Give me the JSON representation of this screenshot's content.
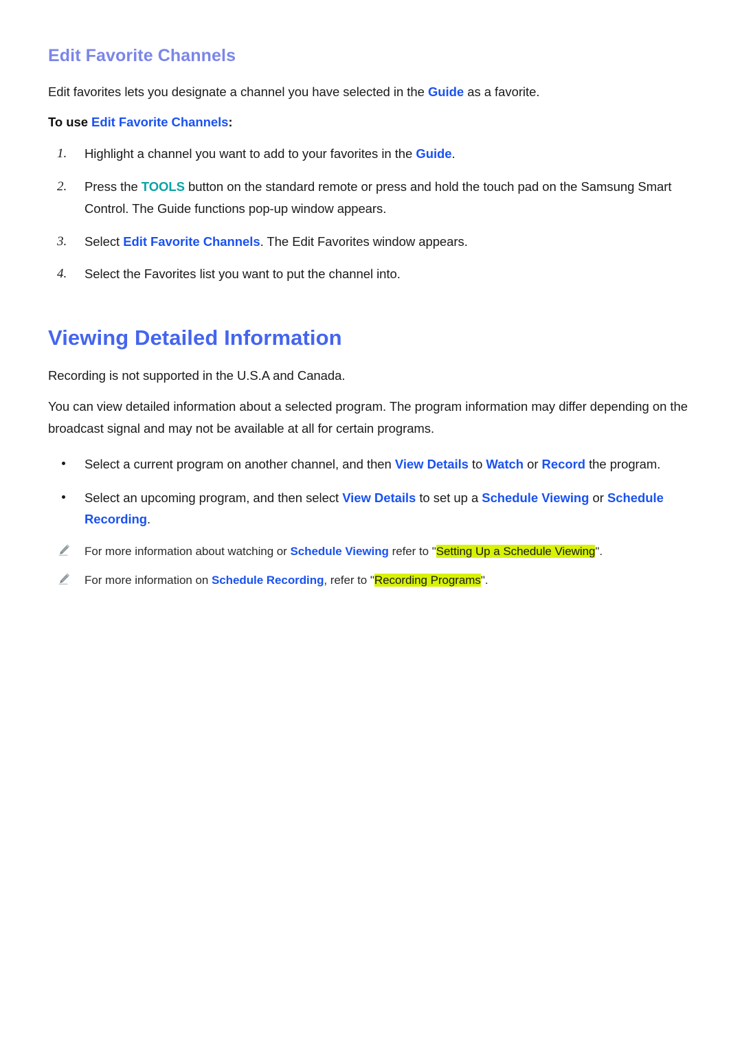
{
  "colors": {
    "section_heading": "#7b86e8",
    "page_heading": "#4565ee",
    "keyword_blue": "#1a52f0",
    "keyword_teal": "#0aa3a3",
    "highlight_green": "#d7f205",
    "body_text": "#1a1a1a",
    "page_background": "#ffffff"
  },
  "section": {
    "heading": "Edit Favorite Channels",
    "intro": {
      "before_guide": "Edit favorites lets you designate a channel you have selected in the ",
      "guide": "Guide",
      "after_guide": " as a favorite."
    },
    "lead_in": {
      "prefix": "To use ",
      "keyword": "Edit Favorite Channels",
      "suffix": ":"
    },
    "steps": [
      {
        "num": "1.",
        "parts": [
          {
            "text": "Highlight a channel you want to add to your favorites in the ",
            "style": "plain"
          },
          {
            "text": "Guide",
            "style": "kw"
          },
          {
            "text": ".",
            "style": "plain"
          }
        ]
      },
      {
        "num": "2.",
        "parts": [
          {
            "text": "Press the ",
            "style": "plain"
          },
          {
            "text": "TOOLS",
            "style": "kw-teal"
          },
          {
            "text": " button on the standard remote or press and hold the touch pad on the Samsung Smart Control. The Guide functions pop-up window appears.",
            "style": "plain"
          }
        ]
      },
      {
        "num": "3.",
        "parts": [
          {
            "text": "Select ",
            "style": "plain"
          },
          {
            "text": "Edit Favorite Channels",
            "style": "kw"
          },
          {
            "text": ". The Edit Favorites window appears.",
            "style": "plain"
          }
        ]
      },
      {
        "num": "4.",
        "parts": [
          {
            "text": "Select the Favorites list you want to put the channel into.",
            "style": "plain"
          }
        ]
      }
    ]
  },
  "chapter": {
    "heading": "Viewing Detailed Information",
    "note_region": "Recording is not supported in the U.S.A and Canada.",
    "description": "You can view detailed information about a selected program. The program information may differ depending on the broadcast signal and may not be available at all for certain programs.",
    "bullets": [
      {
        "parts": [
          {
            "text": "Select a current program on another channel, and then ",
            "style": "plain"
          },
          {
            "text": "View Details",
            "style": "kw"
          },
          {
            "text": " to ",
            "style": "plain"
          },
          {
            "text": "Watch",
            "style": "kw"
          },
          {
            "text": " or ",
            "style": "plain"
          },
          {
            "text": "Record",
            "style": "kw"
          },
          {
            "text": " the program.",
            "style": "plain"
          }
        ]
      },
      {
        "parts": [
          {
            "text": "Select an upcoming program, and then select ",
            "style": "plain"
          },
          {
            "text": "View Details",
            "style": "kw"
          },
          {
            "text": " to set up a ",
            "style": "plain"
          },
          {
            "text": "Schedule Viewing",
            "style": "kw"
          },
          {
            "text": " or ",
            "style": "plain"
          },
          {
            "text": "Schedule Recording",
            "style": "kw"
          },
          {
            "text": ".",
            "style": "plain"
          }
        ]
      }
    ],
    "notes": [
      {
        "icon": "pencil-icon",
        "parts": [
          {
            "text": "For more information about watching or ",
            "style": "plain"
          },
          {
            "text": "Schedule Viewing",
            "style": "kw"
          },
          {
            "text": " refer to \"",
            "style": "plain"
          },
          {
            "text": "Setting Up a Schedule Viewing",
            "style": "hl"
          },
          {
            "text": "\".",
            "style": "plain"
          }
        ]
      },
      {
        "icon": "pencil-icon",
        "parts": [
          {
            "text": "For more information on ",
            "style": "plain"
          },
          {
            "text": "Schedule Recording",
            "style": "kw"
          },
          {
            "text": ", refer to \"",
            "style": "plain"
          },
          {
            "text": "Recording Programs",
            "style": "hl"
          },
          {
            "text": "\".",
            "style": "plain"
          }
        ]
      }
    ]
  }
}
